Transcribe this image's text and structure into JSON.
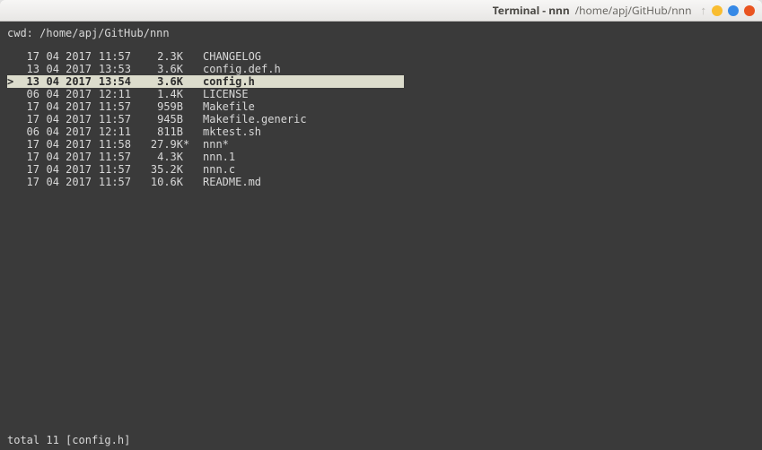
{
  "window": {
    "title": "Terminal - nnn",
    "subtitle": "/home/apj/GitHub/nnn"
  },
  "cwd": {
    "label": "cwd:",
    "path": "/home/apj/GitHub/nnn"
  },
  "files": [
    {
      "cursor": " ",
      "day": "17",
      "mon": "04",
      "year": "2017",
      "time": "11:57",
      "size": "2.3K",
      "flag": " ",
      "name": "CHANGELOG",
      "selected": false
    },
    {
      "cursor": " ",
      "day": "13",
      "mon": "04",
      "year": "2017",
      "time": "13:53",
      "size": "3.6K",
      "flag": " ",
      "name": "config.def.h",
      "selected": false
    },
    {
      "cursor": ">",
      "day": "13",
      "mon": "04",
      "year": "2017",
      "time": "13:54",
      "size": "3.6K",
      "flag": " ",
      "name": "config.h",
      "selected": true
    },
    {
      "cursor": " ",
      "day": "06",
      "mon": "04",
      "year": "2017",
      "time": "12:11",
      "size": "1.4K",
      "flag": " ",
      "name": "LICENSE",
      "selected": false
    },
    {
      "cursor": " ",
      "day": "17",
      "mon": "04",
      "year": "2017",
      "time": "11:57",
      "size": "959B",
      "flag": " ",
      "name": "Makefile",
      "selected": false
    },
    {
      "cursor": " ",
      "day": "17",
      "mon": "04",
      "year": "2017",
      "time": "11:57",
      "size": "945B",
      "flag": " ",
      "name": "Makefile.generic",
      "selected": false
    },
    {
      "cursor": " ",
      "day": "06",
      "mon": "04",
      "year": "2017",
      "time": "12:11",
      "size": "811B",
      "flag": " ",
      "name": "mktest.sh",
      "selected": false
    },
    {
      "cursor": " ",
      "day": "17",
      "mon": "04",
      "year": "2017",
      "time": "11:58",
      "size": "27.9K",
      "flag": "*",
      "name": "nnn*",
      "selected": false
    },
    {
      "cursor": " ",
      "day": "17",
      "mon": "04",
      "year": "2017",
      "time": "11:57",
      "size": "4.3K",
      "flag": " ",
      "name": "nnn.1",
      "selected": false
    },
    {
      "cursor": " ",
      "day": "17",
      "mon": "04",
      "year": "2017",
      "time": "11:57",
      "size": "35.2K",
      "flag": " ",
      "name": "nnn.c",
      "selected": false
    },
    {
      "cursor": " ",
      "day": "17",
      "mon": "04",
      "year": "2017",
      "time": "11:57",
      "size": "10.6K",
      "flag": " ",
      "name": "README.md",
      "selected": false
    }
  ],
  "status": {
    "total_label": "total",
    "total_count": "11",
    "current_file": "[config.h]"
  },
  "colors": {
    "terminal_bg": "#3a3a3a",
    "terminal_fg": "#d8d8d8",
    "selection_bg": "#dcdccc",
    "selection_fg": "#2b2b2b"
  }
}
